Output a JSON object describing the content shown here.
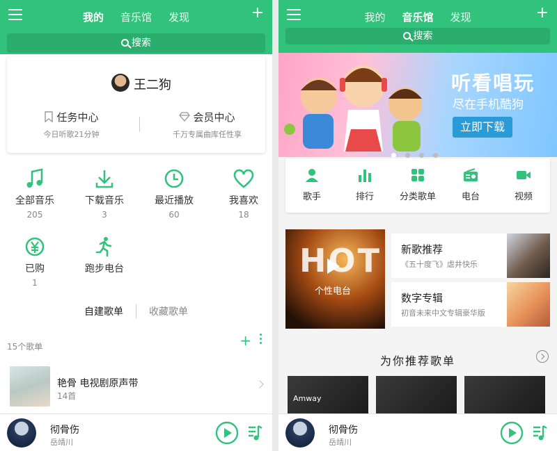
{
  "colors": {
    "accent": "#31c27c",
    "banner_button": "#2b9bd8"
  },
  "screen1": {
    "tabs": [
      "我的",
      "音乐馆",
      "发现"
    ],
    "active_tab": "我的",
    "search": "搜索",
    "user": {
      "name": "王二狗"
    },
    "task": {
      "title": "任务中心",
      "sub": "今日听歌21分钟"
    },
    "vip": {
      "title": "会员中心",
      "sub": "千万专属曲库任性享"
    },
    "grid": [
      {
        "label": "全部音乐",
        "count": "205",
        "icon": "music-note-icon"
      },
      {
        "label": "下载音乐",
        "count": "3",
        "icon": "download-icon"
      },
      {
        "label": "最近播放",
        "count": "60",
        "icon": "clock-icon"
      },
      {
        "label": "我喜欢",
        "count": "18",
        "icon": "heart-icon"
      },
      {
        "label": "已购",
        "count": "1",
        "icon": "yen-icon"
      },
      {
        "label": "跑步电台",
        "count": "",
        "icon": "runner-icon"
      }
    ],
    "segments": {
      "created": "自建歌单",
      "collected": "收藏歌单"
    },
    "playlist_count": "15个歌单",
    "playlist": {
      "title": "艳骨 电视剧原声带",
      "sub": "14首"
    }
  },
  "screen2": {
    "tabs": [
      "我的",
      "音乐馆",
      "发现"
    ],
    "active_tab": "音乐馆",
    "search": "搜索",
    "banner": {
      "title": "听看唱玩",
      "sub": "尽在手机酷狗",
      "button": "立即下载"
    },
    "categories": [
      "歌手",
      "排行",
      "分类歌单",
      "电台",
      "视频"
    ],
    "hot": {
      "text": "HOT",
      "sub": "个性电台"
    },
    "rec1": {
      "title": "新歌推荐",
      "sub": "《五十度飞》虐井快乐"
    },
    "rec2": {
      "title": "数字专辑",
      "sub": "初音未来中文专辑豪华版"
    },
    "section_title": "为你推荐歌单",
    "tile_text": "Amway"
  },
  "player": {
    "title": "彻骨伤",
    "artist": "岳靖川"
  }
}
